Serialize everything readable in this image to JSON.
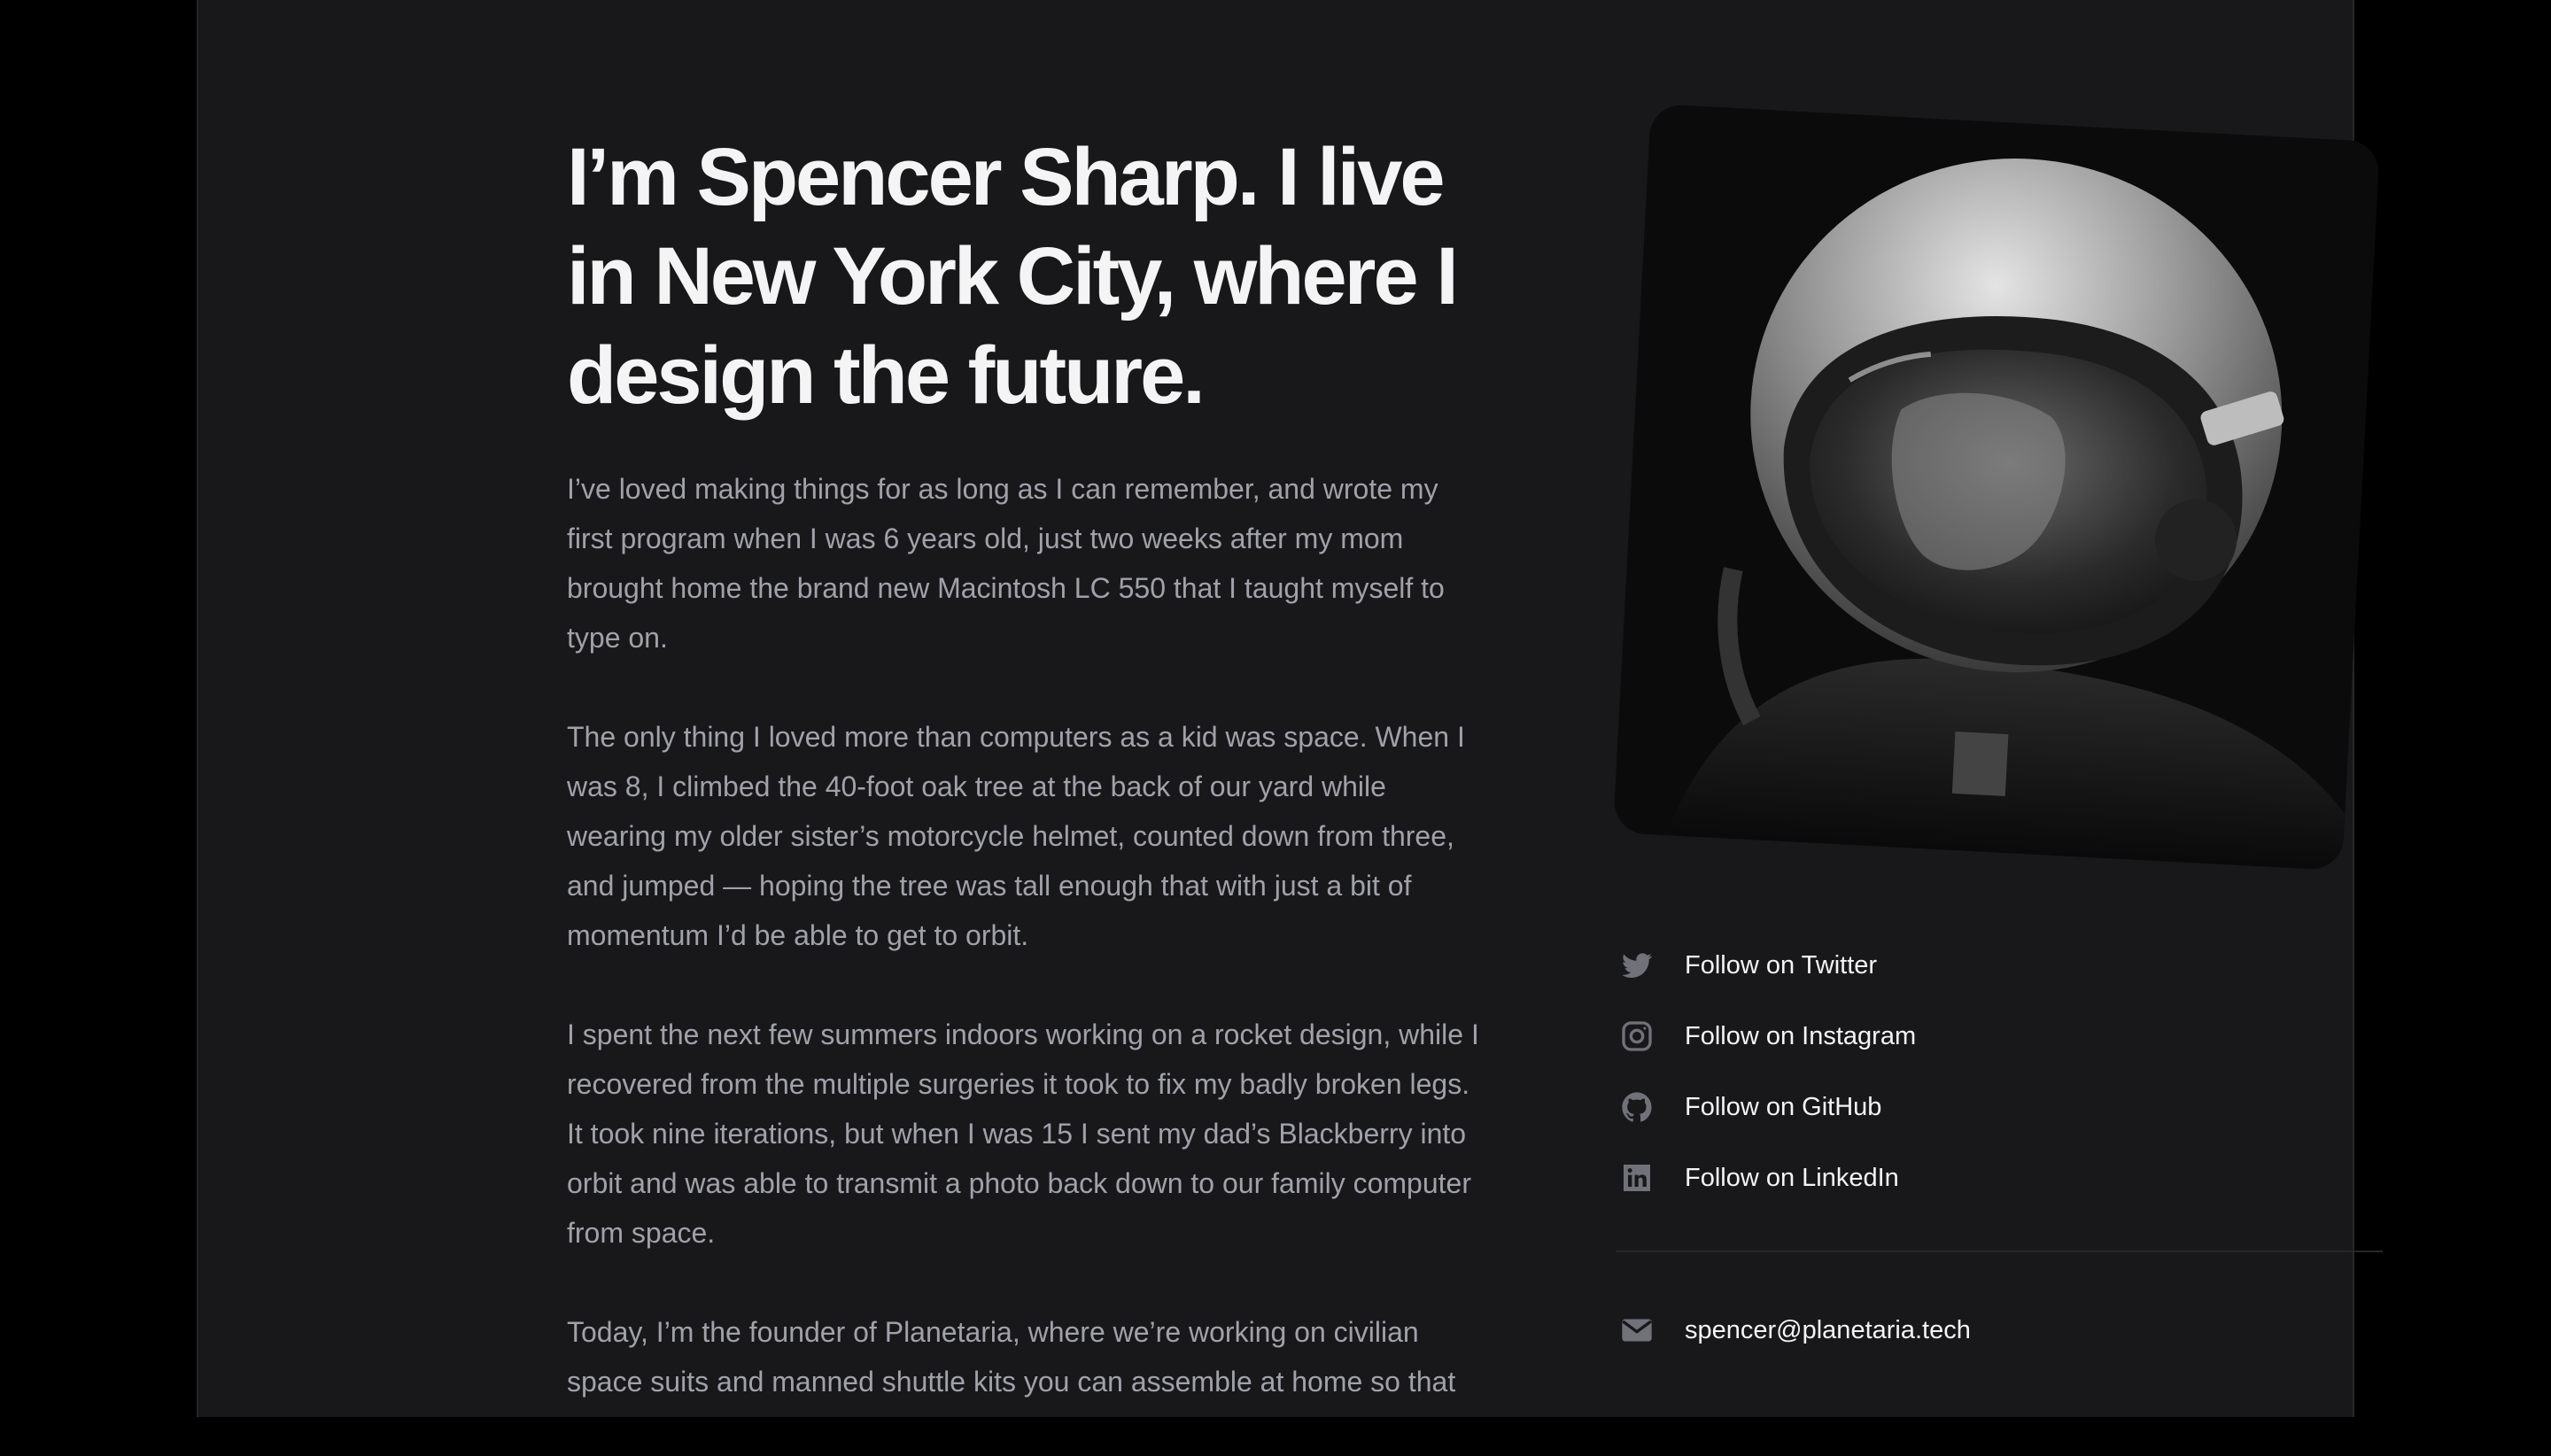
{
  "hero": {
    "headline": "I’m Spencer Sharp. I live in New York City, where I design the future."
  },
  "bio": {
    "paragraphs": [
      "I’ve loved making things for as long as I can remember, and wrote my first program when I was 6 years old, just two weeks after my mom brought home the brand new Macintosh LC 550 that I taught myself to type on.",
      "The only thing I loved more than computers as a kid was space. When I was 8, I climbed the 40-foot oak tree at the back of our yard while wearing my older sister’s motorcycle helmet, counted down from three, and jumped — hoping the tree was tall enough that with just a bit of momentum I’d be able to get to orbit.",
      "I spent the next few summers indoors working on a rocket design, while I recovered from the multiple surgeries it took to fix my badly broken legs. It took nine iterations, but when I was 15 I sent my dad’s Blackberry into orbit and was able to transmit a photo back down to our family computer from space.",
      "Today, I’m the founder of Planetaria, where we’re working on civilian space suits and manned shuttle kits you can assemble at home so that"
    ]
  },
  "social": {
    "links": [
      {
        "label": "Follow on Twitter",
        "icon": "twitter-icon"
      },
      {
        "label": "Follow on Instagram",
        "icon": "instagram-icon"
      },
      {
        "label": "Follow on GitHub",
        "icon": "github-icon"
      },
      {
        "label": "Follow on LinkedIn",
        "icon": "linkedin-icon"
      }
    ],
    "email": {
      "label": "spencer@planetaria.tech",
      "icon": "mail-icon"
    }
  },
  "colors": {
    "background": "#000000",
    "panel": "#18181b",
    "heading": "#f4f4f5",
    "body_text": "#a1a1aa",
    "icon": "#71717a",
    "divider": "#27272a"
  }
}
